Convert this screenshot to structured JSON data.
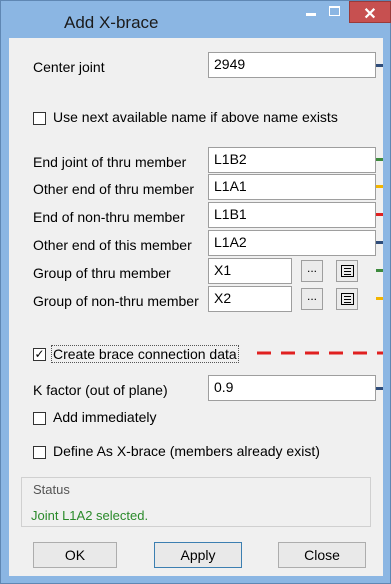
{
  "window": {
    "title": "Add X-brace",
    "close_glyph": "✕"
  },
  "center_joint": {
    "label": "Center joint",
    "value": "2949"
  },
  "use_next_name": {
    "label": "Use next available name if above name exists",
    "checked": false
  },
  "fields": [
    {
      "label": "End joint of thru member",
      "value": "L1B2",
      "line_color": "#3d8a3d"
    },
    {
      "label": "Other end of thru member",
      "value": "L1A1",
      "line_color": "#f2b400"
    },
    {
      "label": "End of non-thru member",
      "value": "L1B1",
      "line_color": "#e02020"
    },
    {
      "label": "Other end of this member",
      "value": "L1A2",
      "line_color": "#2f4d7a"
    }
  ],
  "groups": [
    {
      "label": "Group of thru member",
      "value": "X1",
      "browse_label": "...",
      "list_icon": "list-icon",
      "line_color": "#3d8a3d"
    },
    {
      "label": "Group of non-thru member",
      "value": "X2",
      "browse_label": "...",
      "list_icon": "list-icon",
      "line_color": "#f2b400"
    }
  ],
  "create_connection": {
    "label": "Create brace connection data",
    "checked": true,
    "check_glyph": "✓",
    "line_color": "#e02020"
  },
  "k_factor": {
    "label": "K factor (out of plane)",
    "value": "0.9",
    "line_color": "#2f4d7a"
  },
  "add_immediately": {
    "label": "Add immediately",
    "checked": false
  },
  "define_existing": {
    "label": "Define As X-brace  (members already exist)",
    "checked": false
  },
  "status": {
    "title": "Status",
    "text": "Joint L1A2 selected."
  },
  "buttons": {
    "ok": "OK",
    "apply": "Apply",
    "close": "Close"
  },
  "colors": {
    "window_frame": "#8bb6e3",
    "client_bg": "#f0f0f0",
    "close_button": "#c75050",
    "status_text": "#2a8a2a"
  }
}
